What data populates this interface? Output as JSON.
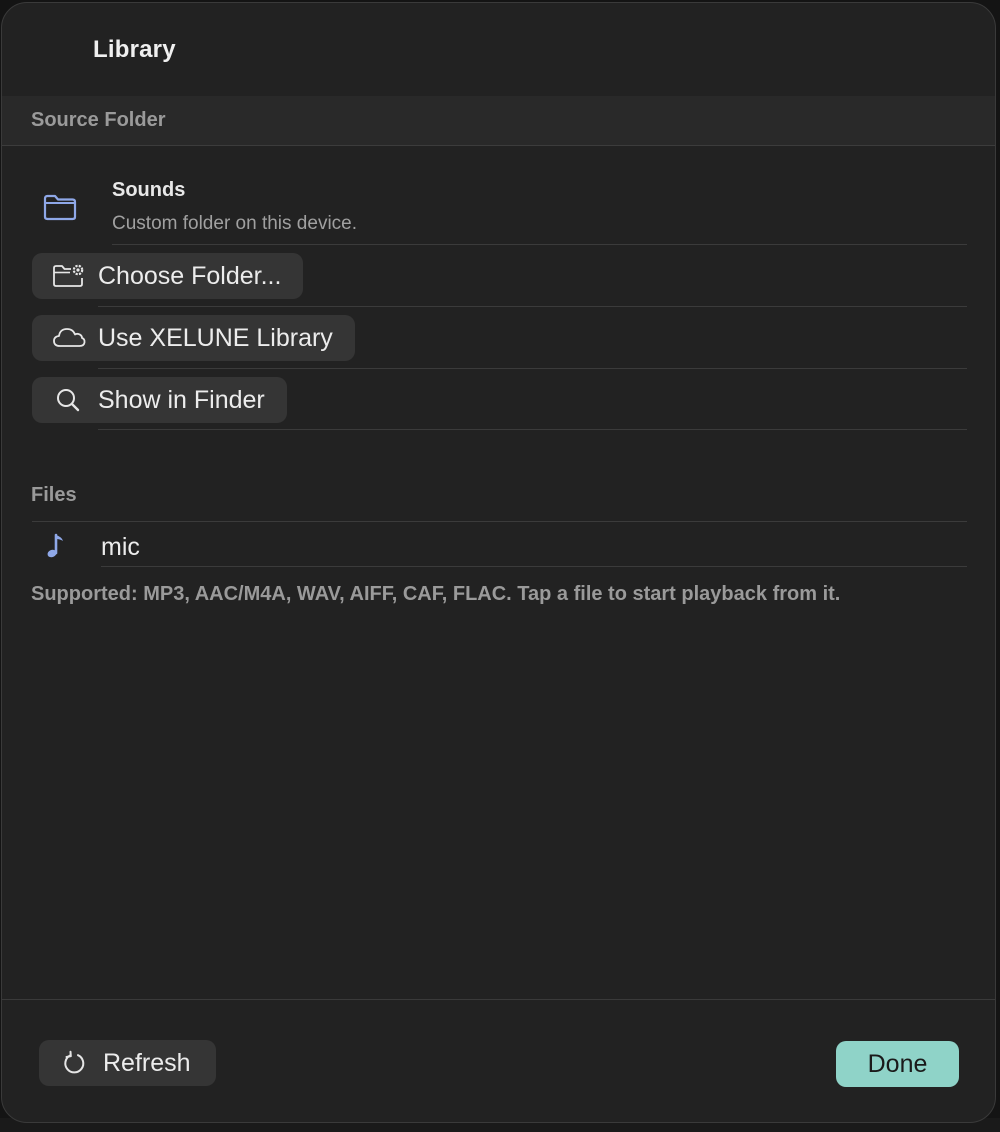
{
  "dialog": {
    "title": "Library"
  },
  "source_folder": {
    "header": "Source Folder",
    "folder_name": "Sounds",
    "folder_description": "Custom folder on this device.",
    "folder_icon": "folder-icon",
    "actions": [
      {
        "label": "Choose Folder...",
        "icon": "folder-gear-icon"
      },
      {
        "label": "Use XELUNE Library",
        "icon": "cloud-icon"
      },
      {
        "label": "Show in Finder",
        "icon": "magnifier-icon"
      }
    ]
  },
  "files": {
    "header": "Files",
    "items": [
      {
        "name": "mic",
        "icon": "music-note-icon"
      }
    ],
    "supported_note": "Supported: MP3, AAC/M4A, WAV, AIFF, CAF, FLAC. Tap a file to start playback from it."
  },
  "footer": {
    "refresh_label": "Refresh",
    "refresh_icon": "refresh-icon",
    "done_label": "Done"
  },
  "colors": {
    "accent": "#8fd3c8",
    "icon_blue": "#8fa8e8",
    "background": "#222222",
    "button_bg": "#353535"
  }
}
